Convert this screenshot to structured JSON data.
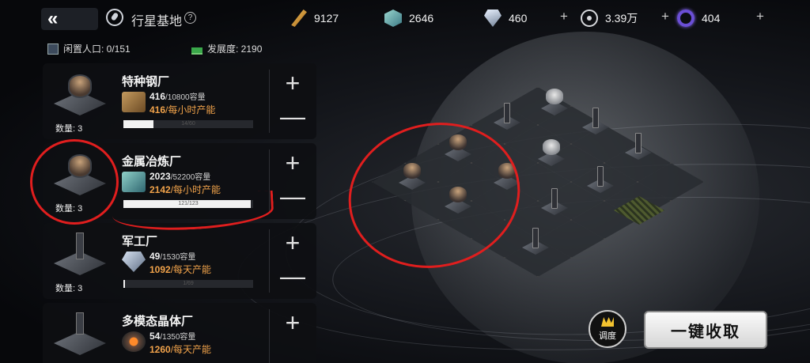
{
  "header": {
    "back_label": "«",
    "title": "行星基地",
    "help_label": "?"
  },
  "resources": [
    {
      "icon": "feather-icon",
      "value": "9127"
    },
    {
      "icon": "cube-icon",
      "value": "2646"
    },
    {
      "icon": "crystal-icon",
      "value": "460"
    },
    {
      "icon": "atom-icon",
      "value": "3.39万"
    },
    {
      "icon": "ring-icon",
      "value": "404"
    }
  ],
  "plus_label": "+",
  "stats": {
    "idle": "闲置人口: 0/151",
    "development": "发展度: 2190"
  },
  "factories": [
    {
      "name": "特种钢厂",
      "amount": "416",
      "capacity": "/10800容量",
      "rate": "416",
      "rate_unit": "/每小时产能",
      "progress": "14/60",
      "progress_value": 0.23,
      "count": "数量: 3"
    },
    {
      "name": "金属冶炼厂",
      "amount": "2023",
      "capacity": "/52200容量",
      "rate": "2142",
      "rate_unit": "/每小时产能",
      "progress": "121/123",
      "progress_value": 0.98,
      "count": "数量: 3"
    },
    {
      "name": "军工厂",
      "amount": "49",
      "capacity": "/1530容量",
      "rate": "1092",
      "rate_unit": "/每天产能",
      "progress": "1/69",
      "progress_value": 0.015,
      "count": "数量: 3"
    },
    {
      "name": "多模态晶体厂",
      "amount": "54",
      "capacity": "/1350容量",
      "rate": "1260",
      "rate_unit": "/每天产能",
      "progress": "",
      "progress_value": 0,
      "count": ""
    }
  ],
  "controls": {
    "plus": "+",
    "minus": "—"
  },
  "buttons": {
    "dispatch": "调度",
    "collect_all": "一键收取"
  },
  "colors": {
    "accent_orange": "#f0a24a",
    "annotation_red": "#e01e1e"
  }
}
